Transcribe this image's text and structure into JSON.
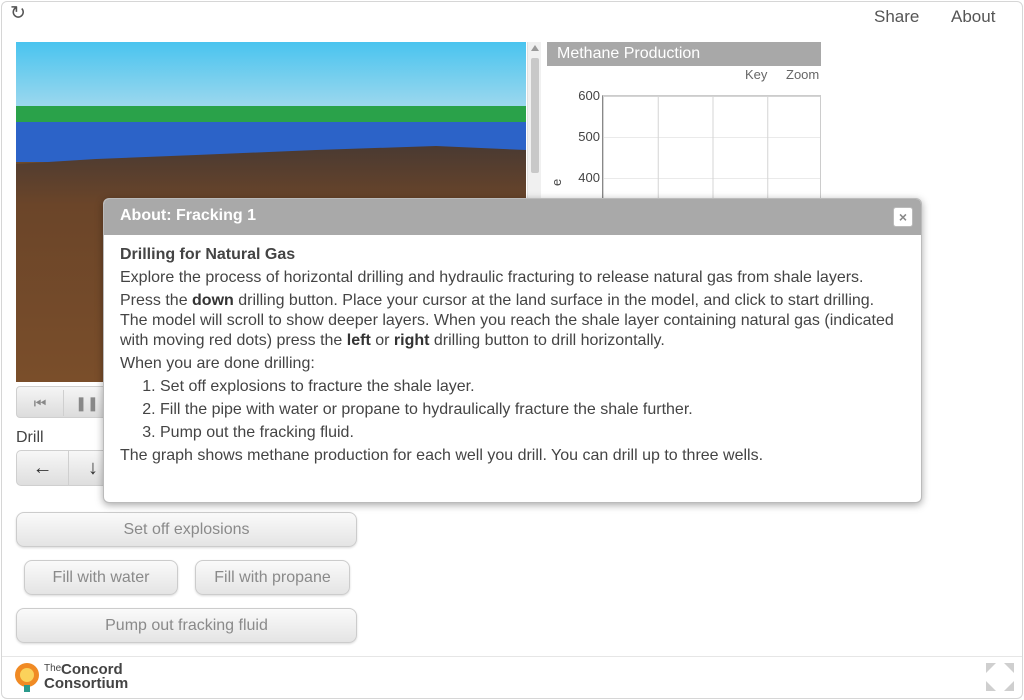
{
  "topbar": {
    "reload_icon": "reload-icon",
    "share": "Share",
    "about": "About"
  },
  "graph": {
    "title": "Methane Production",
    "key": "Key",
    "zoom": "Zoom",
    "y_axis_label_visible": "e",
    "y_ticks": [
      "600",
      "500",
      "400"
    ]
  },
  "chart_data": {
    "type": "line",
    "title": "Methane Production",
    "series": [],
    "ylim": [
      300,
      600
    ],
    "y_ticks": [
      600,
      500,
      400
    ],
    "grid": true
  },
  "controls": {
    "drill_label": "Drill",
    "drill_left": "←",
    "drill_down": "↓",
    "set_off_explosions": "Set off explosions",
    "fill_water": "Fill with water",
    "fill_propane": "Fill with propane",
    "pump_out": "Pump out fracking fluid"
  },
  "footer": {
    "logo_small": "The",
    "logo_line1": "Concord",
    "logo_line2": "Consortium",
    "logo_color": "#f08a24"
  },
  "dialog": {
    "title": "About: Fracking 1",
    "close": "×",
    "heading": "Drilling for Natural Gas",
    "p1": "Explore the process of horizontal drilling and hydraulic fracturing to release natural gas from shale layers.",
    "p2_a": "Press the ",
    "p2_down": "down",
    "p2_b": " drilling button. Place your cursor at the land surface in the model, and click to start drilling. The model will scroll to show deeper layers. When you reach the shale layer containing natural gas (indicated with moving red dots) press the ",
    "p2_left": "left",
    "p2_or": " or ",
    "p2_right": "right",
    "p2_c": " drilling button to drill horizontally.",
    "p3": "When you are done drilling:",
    "steps": [
      "Set off explosions to fracture the shale layer.",
      "Fill the pipe with water or propane to hydraulically fracture the shale further.",
      "Pump out the fracking fluid."
    ],
    "p4": "The graph shows methane production for each well you drill. You can drill up to three wells."
  },
  "colors": {
    "sky_top": "#49c4ef",
    "sky_bottom": "#9ed8ee",
    "grass": "#2aa24a",
    "water": "#2c63c8",
    "soil": "#6b4a2b"
  }
}
